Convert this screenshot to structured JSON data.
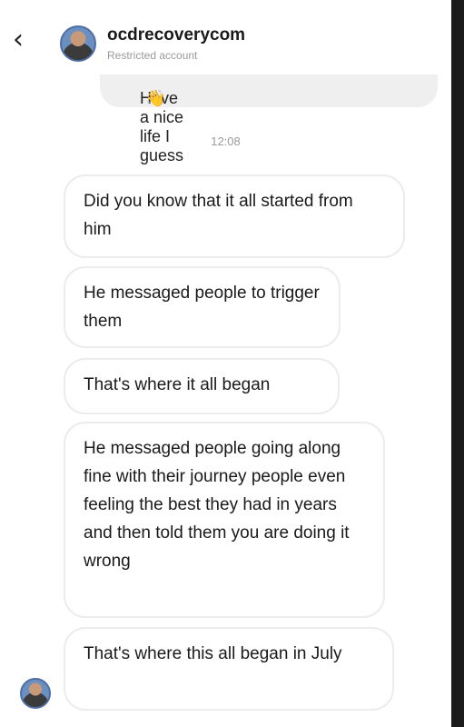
{
  "header": {
    "back_icon": "chevron-left-icon",
    "username": "ocdrecoverycom",
    "subtitle": "Restricted account"
  },
  "sent_message": {
    "text": "Have a nice life I guess",
    "emoji": "👋"
  },
  "timestamp": "12:08",
  "received_messages": [
    {
      "text": "Did you know that it all started from him"
    },
    {
      "text": "He messaged people to trigger them"
    },
    {
      "text": "That's where it all began"
    },
    {
      "text": "He messaged people going along fine with their journey people even feeling the best they had in years and then told them you are doing it wrong"
    },
    {
      "text": "That's where this all began in July"
    }
  ],
  "colors": {
    "bubble_border": "#ececec",
    "sent_bubble": "#efefef",
    "avatar_bg": "#6c8fc2"
  }
}
